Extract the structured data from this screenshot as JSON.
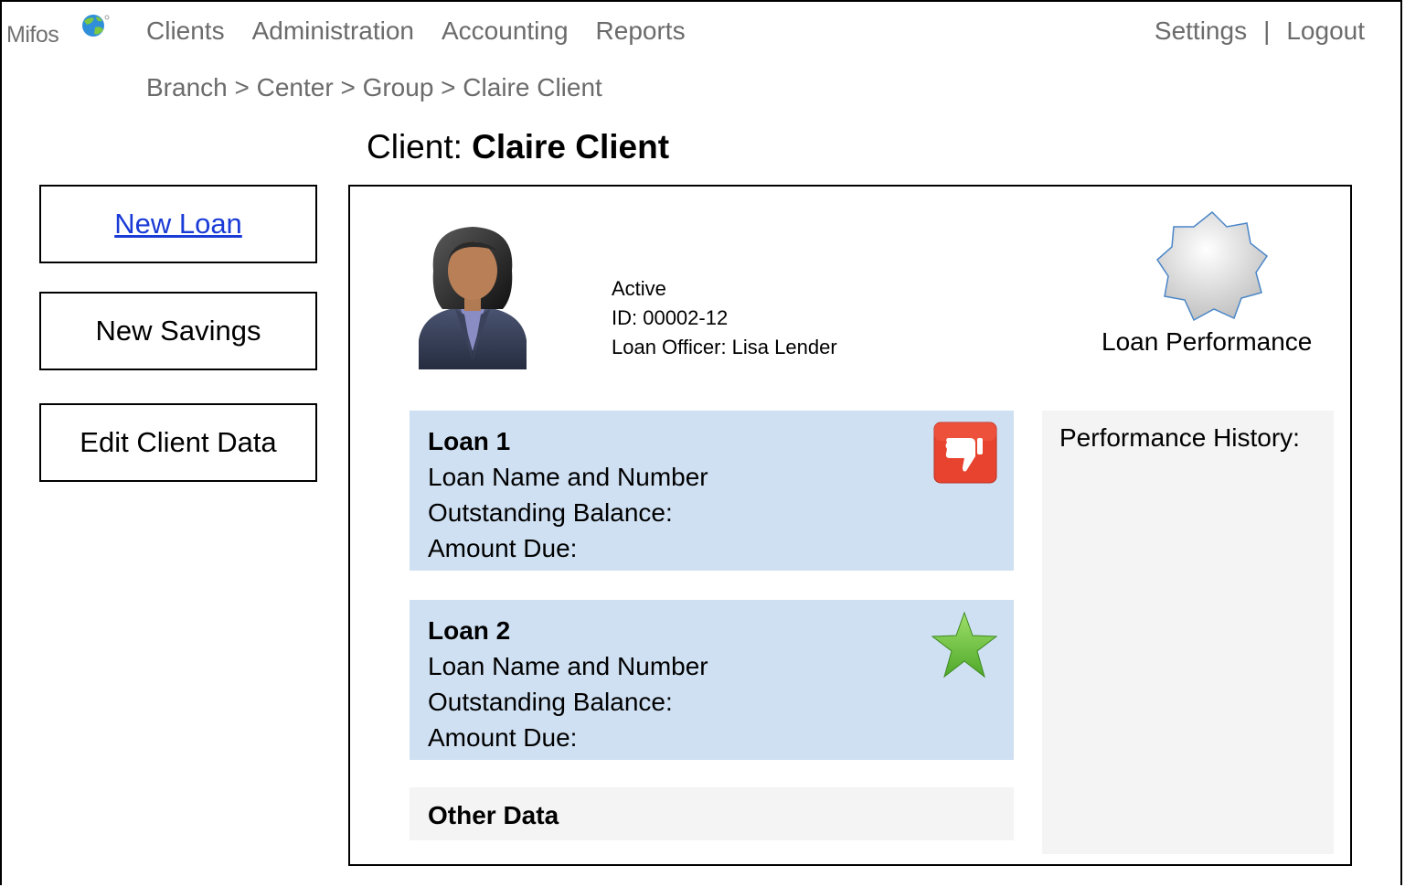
{
  "app": {
    "logo_text": "Mifos"
  },
  "nav": {
    "items": [
      "Clients",
      "Administration",
      "Accounting",
      "Reports"
    ],
    "settings": "Settings",
    "separator": "|",
    "logout": "Logout"
  },
  "breadcrumb": "Branch > Center > Group  > Claire Client",
  "page_title": {
    "prefix": "Client: ",
    "name": "Claire Client"
  },
  "actions": {
    "new_loan": "New Loan",
    "new_savings": "New Savings",
    "edit_client": "Edit Client Data"
  },
  "client": {
    "status": "Active",
    "id": "ID: 00002-12",
    "loan_officer": "Loan Officer: Lisa Lender",
    "performance_label": "Loan Performance"
  },
  "loans": [
    {
      "title": "Loan 1",
      "name": "Loan Name and Number",
      "balance": "Outstanding Balance:",
      "due": "Amount Due:",
      "icon": "thumbs-down-icon"
    },
    {
      "title": "Loan 2",
      "name": "Loan Name and Number",
      "balance": "Outstanding Balance:",
      "due": "Amount Due:",
      "icon": "star-icon"
    }
  ],
  "other_data": "Other Data",
  "performance_history": "Performance History:",
  "colors": {
    "nav_text": "#6b6b6b",
    "link": "#1a3bd6",
    "loan_bg": "#cfe0f2",
    "panel_gray": "#f4f4f4",
    "thumbs_down": "#e8432f",
    "star": "#7cc843"
  }
}
